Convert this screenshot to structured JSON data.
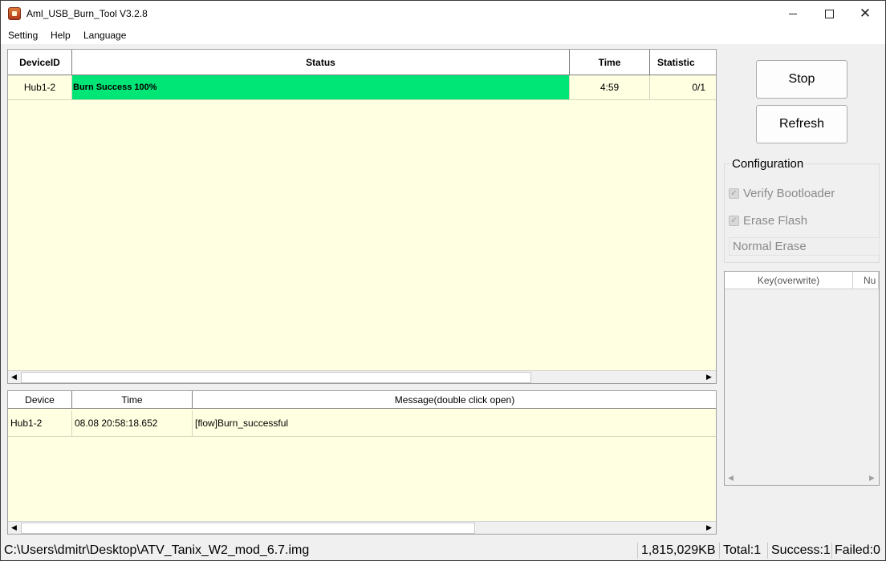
{
  "window": {
    "title": "Aml_USB_Burn_Tool V3.2.8",
    "minimize_glyph": "",
    "close_glyph": "✕"
  },
  "menu": [
    "Setting",
    "Help",
    "Language"
  ],
  "device_grid": {
    "columns": [
      "DeviceID",
      "Status",
      "Time",
      "Statistic"
    ],
    "rows": [
      {
        "device_id": "Hub1-2",
        "status": "Burn Success 100%",
        "progress_percent": 100,
        "time": "4:59",
        "statistic": "0/1"
      }
    ],
    "status_color": "#00e676"
  },
  "log_grid": {
    "columns": [
      "Device",
      "Time",
      "Message(double click open)"
    ],
    "rows": [
      {
        "device": "Hub1-2",
        "time": "08.08 20:58:18.652",
        "message": "[flow]Burn_successful"
      }
    ]
  },
  "buttons": {
    "stop": "Stop",
    "refresh": "Refresh"
  },
  "configuration": {
    "title": "Configuration",
    "verify_bootloader": "Verify Bootloader",
    "erase_flash": "Erase Flash",
    "erase_mode": "Normal Erase"
  },
  "key_list": {
    "columns": [
      "Key(overwrite)",
      "Nu"
    ]
  },
  "statusbar": {
    "image_path": "C:\\Users\\dmitr\\Desktop\\ATV_Tanix_W2_mod_6.7.img",
    "size": "1,815,029KB",
    "total": "Total:1",
    "success": "Success:1",
    "failed": "Failed:0"
  },
  "icons": [
    "app-icon",
    "minimize-icon",
    "maximize-icon",
    "close-icon",
    "checkbox-checked-icon",
    "scroll-left-icon",
    "scroll-right-icon"
  ]
}
